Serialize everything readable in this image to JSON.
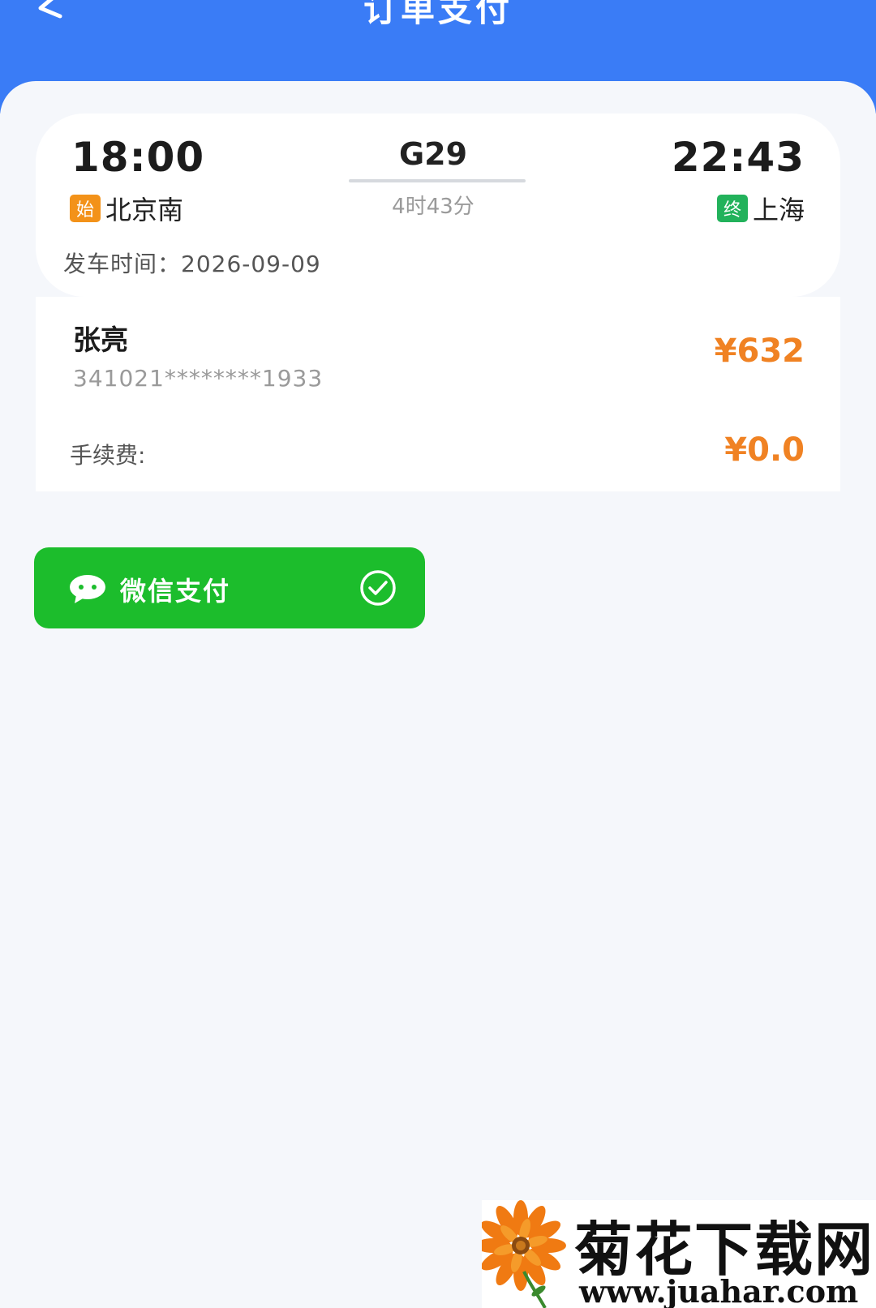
{
  "header": {
    "title": "订单支付"
  },
  "trip": {
    "departure_time": "18:00",
    "arrival_time": "22:43",
    "departure_tag": "始",
    "departure_station": "北京南",
    "arrival_tag": "终",
    "arrival_station": "上海",
    "train_number": "G29",
    "duration": "4时43分",
    "depart_date": "发车时间：2026-09-09"
  },
  "passenger": {
    "name": "张亮",
    "id_number": "341021********1933",
    "price": "¥632",
    "fee_label": "手续费:",
    "fee_value": "¥0.0"
  },
  "payment": {
    "method_label": "微信支付",
    "selected": true
  },
  "watermark": {
    "title": "菊花下载网",
    "url": "www.juahar.com"
  },
  "colors": {
    "header_bg": "#3a7cf6",
    "price": "#f08223",
    "wechat_green": "#1cbd2c",
    "start_tag": "#f39219",
    "end_tag": "#22b25b"
  }
}
